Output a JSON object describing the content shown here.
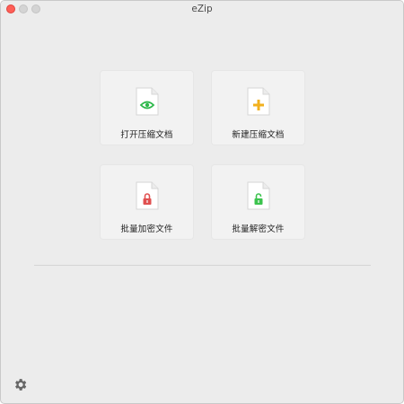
{
  "window": {
    "title": "eZip"
  },
  "actions": [
    {
      "label": "打开压缩文档",
      "icon": "eye-icon",
      "accent": "#2eb84b"
    },
    {
      "label": "新建压缩文档",
      "icon": "plus-icon",
      "accent": "#f2b01e"
    },
    {
      "label": "批量加密文件",
      "icon": "lock-icon",
      "accent": "#e05050"
    },
    {
      "label": "批量解密文件",
      "icon": "unlock-icon",
      "accent": "#3cc34e"
    }
  ],
  "footer": {
    "settings_icon": "gear-icon"
  }
}
